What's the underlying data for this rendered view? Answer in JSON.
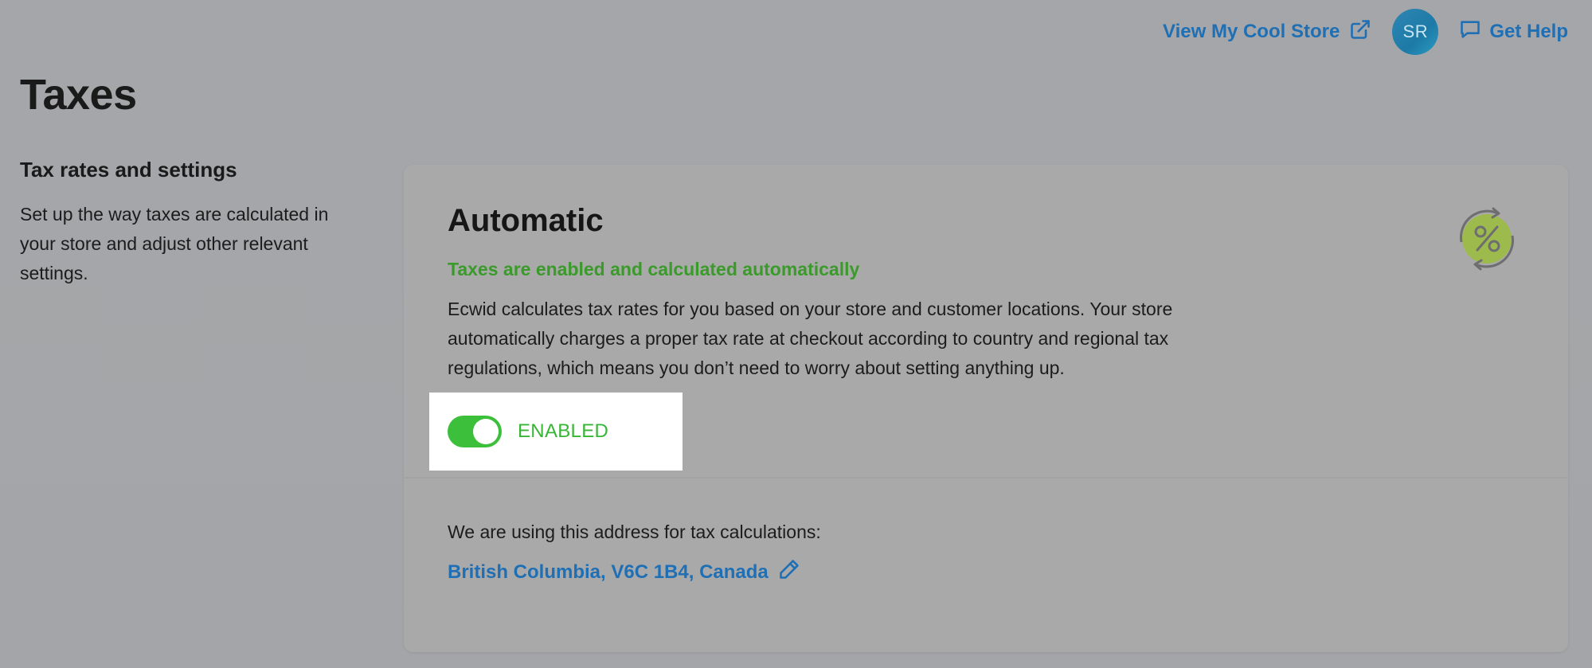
{
  "header": {
    "view_store_label": "View My Cool Store",
    "avatar_initials": "SR",
    "help_label": "Get Help"
  },
  "page": {
    "title": "Taxes"
  },
  "section": {
    "heading": "Tax rates and settings",
    "description": "Set up the way taxes are calculated in your store and adjust other relevant settings."
  },
  "card": {
    "title": "Automatic",
    "status": "Taxes are enabled and calculated automatically",
    "description": "Ecwid calculates tax rates for you based on your store and customer locations. Your store automatically charges a proper tax rate at checkout according to country and regional tax regulations, which means you don’t need to worry about setting anything up.",
    "toggle": {
      "state": "on",
      "label": "ENABLED"
    },
    "icon": "percent-refresh-icon",
    "address_caption": "We are using this address for tax calculations:",
    "address_value": "British Columbia, V6C 1B4, Canada"
  },
  "colors": {
    "link": "#1f6fb5",
    "success": "#3a9a2a",
    "toggle_on": "#3cbf3a",
    "avatar": "#1d7aa6"
  }
}
